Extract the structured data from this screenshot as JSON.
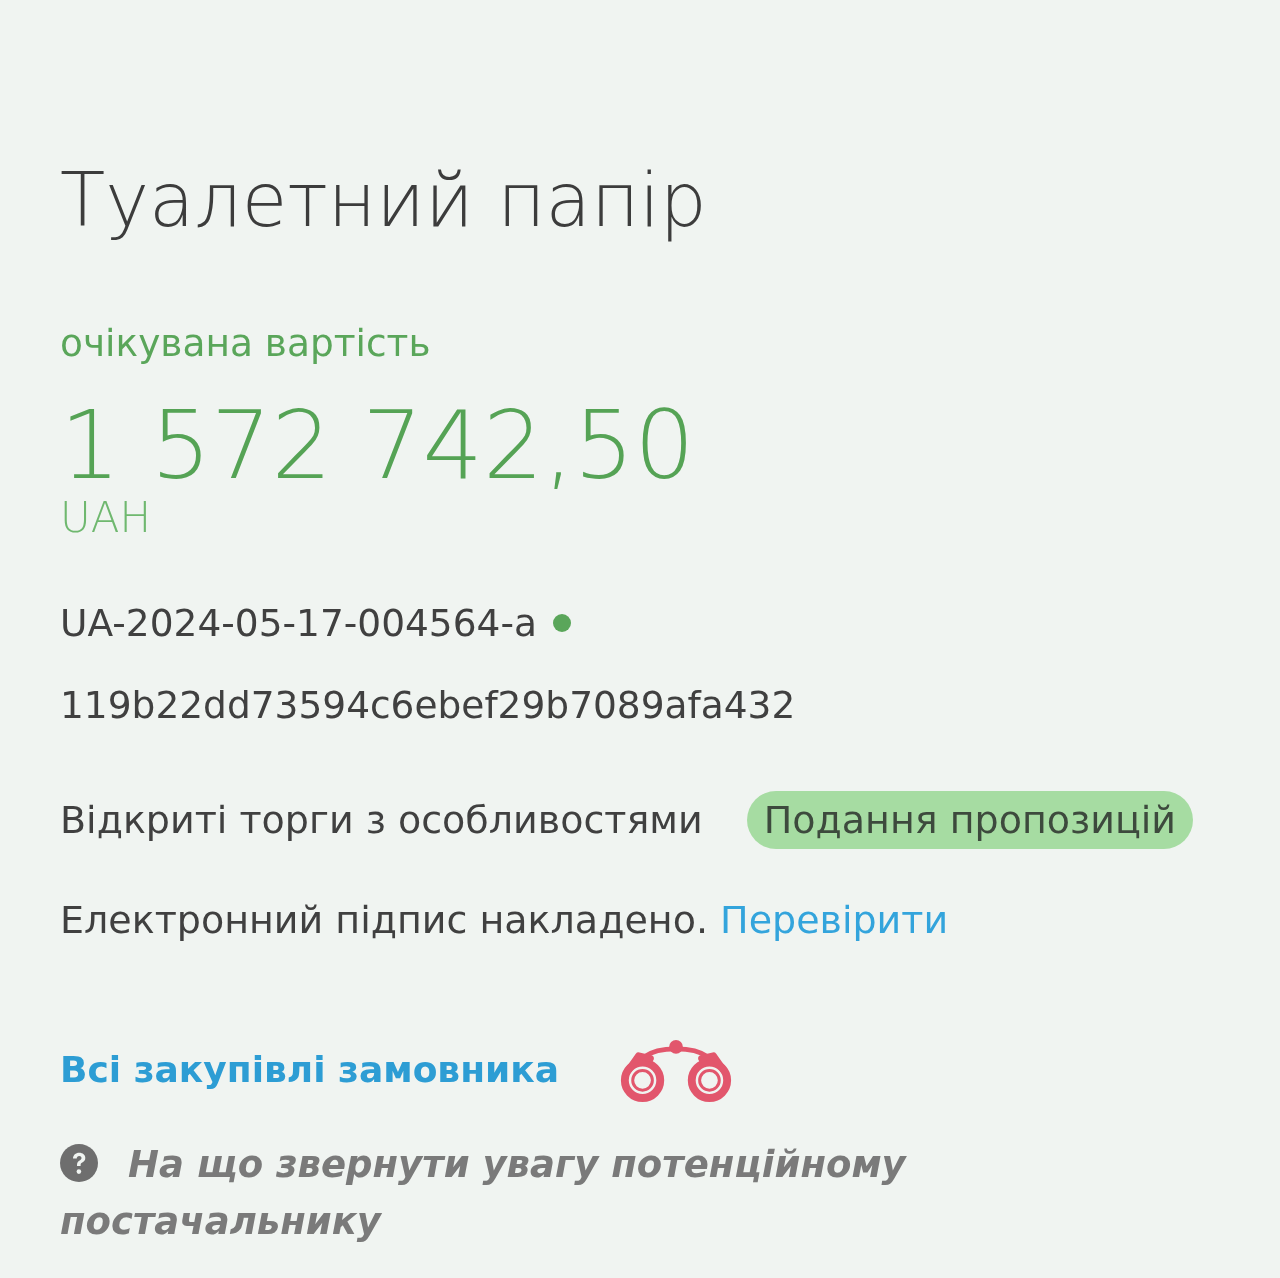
{
  "title": "Туалетний папір",
  "expected_value": {
    "label": "очікувана вартість",
    "amount": "1 572 742,50",
    "currency": "UAH"
  },
  "tender_id": "UA-2024-05-17-004564-a",
  "hash": "119b22dd73594c6ebef29b7089afa432",
  "procedure": {
    "type": "Відкриті торги з особливостями",
    "status": "Подання пропозицій"
  },
  "signature": {
    "text": "Електронний підпис накладено.",
    "link": "Перевірити"
  },
  "buyer_link": "Всі закупівлі замовника",
  "hint": "На що звернути увагу потенційному постачальнику"
}
